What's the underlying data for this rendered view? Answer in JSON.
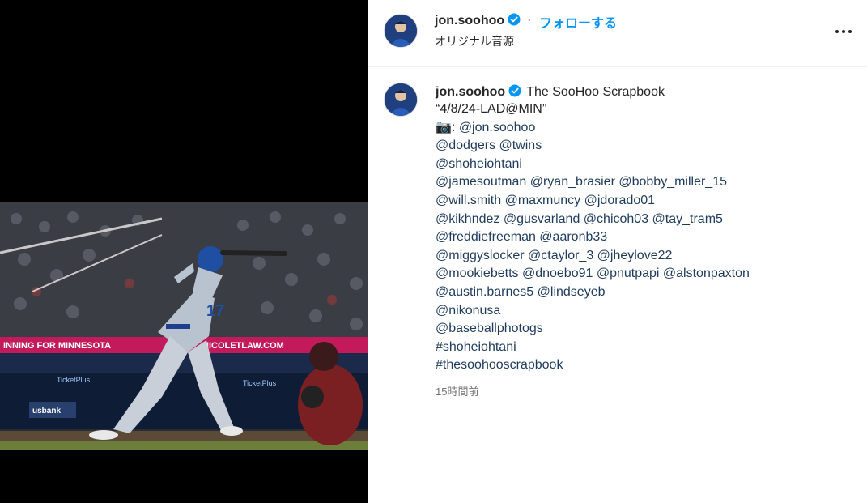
{
  "post": {
    "username": "jon.soohoo",
    "follow_label": "フォローする",
    "separator": "·",
    "audio_label": "オリジナル音源"
  },
  "caption": {
    "username": "jon.soohoo",
    "title": "The SooHoo Scrapbook",
    "lines": [
      "“4/8/24-LAD@MIN”",
      "📷: @jon.soohoo",
      "@dodgers @twins",
      "@shoheiohtani",
      "@jamesoutman @ryan_brasier @bobby_miller_15",
      "@will.smith @maxmuncy @jdorado01",
      "@kikhndez @gusvarland @chicoh03 @tay_tram5",
      "@freddiefreeman @aaronb33",
      "@miggyslocker @ctaylor_3 @jheylove22",
      "@mookiebetts @dnoebo91 @pnutpapi @alstonpaxton",
      "@austin.barnes5 @lindseyeb",
      "@nikonusa",
      "@baseballphotogs",
      "#shoheiohtani",
      "#thesoohooscrapbook"
    ],
    "timestamp": "15時間前"
  },
  "photo": {
    "banner_left": "INNING FOR MINNESOTA",
    "banner_right": "NICOLETLAW.COM",
    "sign_1": "TicketPlus",
    "sign_2": "usbank",
    "jersey_number": "17"
  },
  "colors": {
    "accent": "#0095f6",
    "verified": "#0095f6",
    "caption_text": "#1f3b5c"
  },
  "icons": [
    "verified-badge-icon",
    "more-options-icon"
  ]
}
